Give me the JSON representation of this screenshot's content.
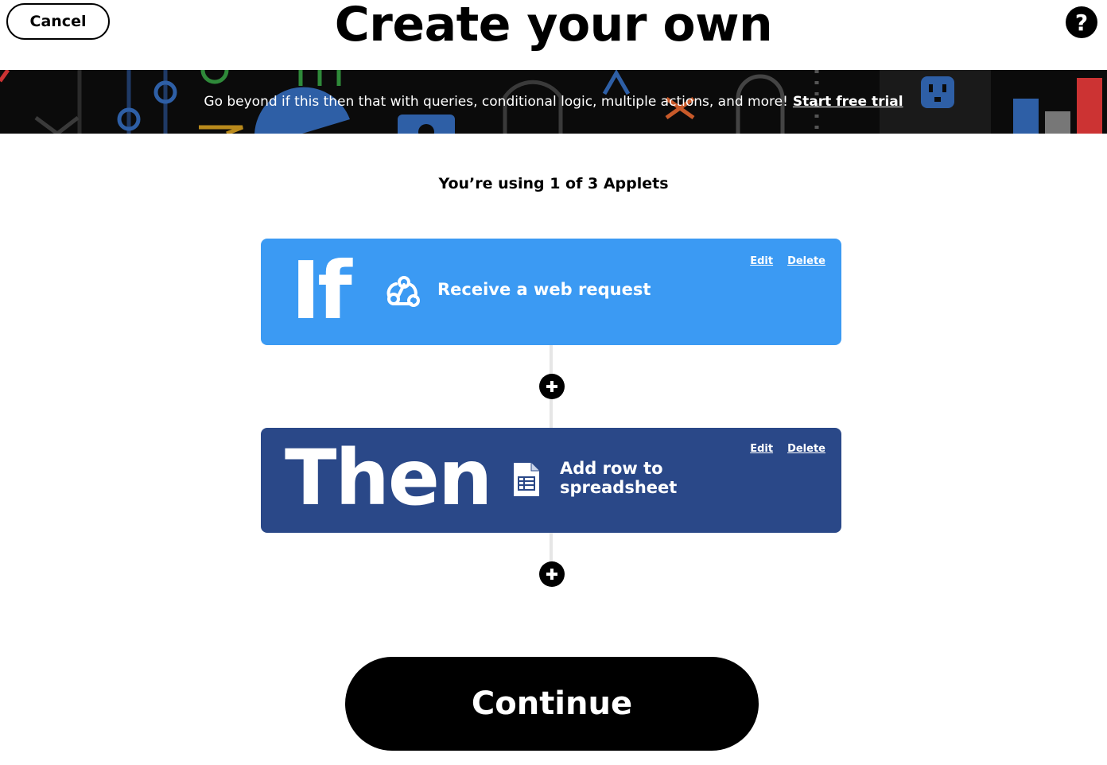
{
  "header": {
    "cancel_label": "Cancel",
    "title": "Create your own",
    "help_icon": "question-mark-icon"
  },
  "banner": {
    "message": "Go beyond if this then that with queries, conditional logic, multiple actions, and more!",
    "cta_label": "Start free trial"
  },
  "usage_text": "You’re using 1 of 3 Applets",
  "trigger": {
    "keyword": "If",
    "service_icon": "webhooks-icon",
    "label": "Receive a web request",
    "edit_label": "Edit",
    "delete_label": "Delete",
    "color": "#3b9af3"
  },
  "action": {
    "keyword": "Then",
    "service_icon": "google-sheets-icon",
    "label": "Add row to spreadsheet",
    "edit_label": "Edit",
    "delete_label": "Delete",
    "color": "#2a4888"
  },
  "continue_label": "Continue"
}
